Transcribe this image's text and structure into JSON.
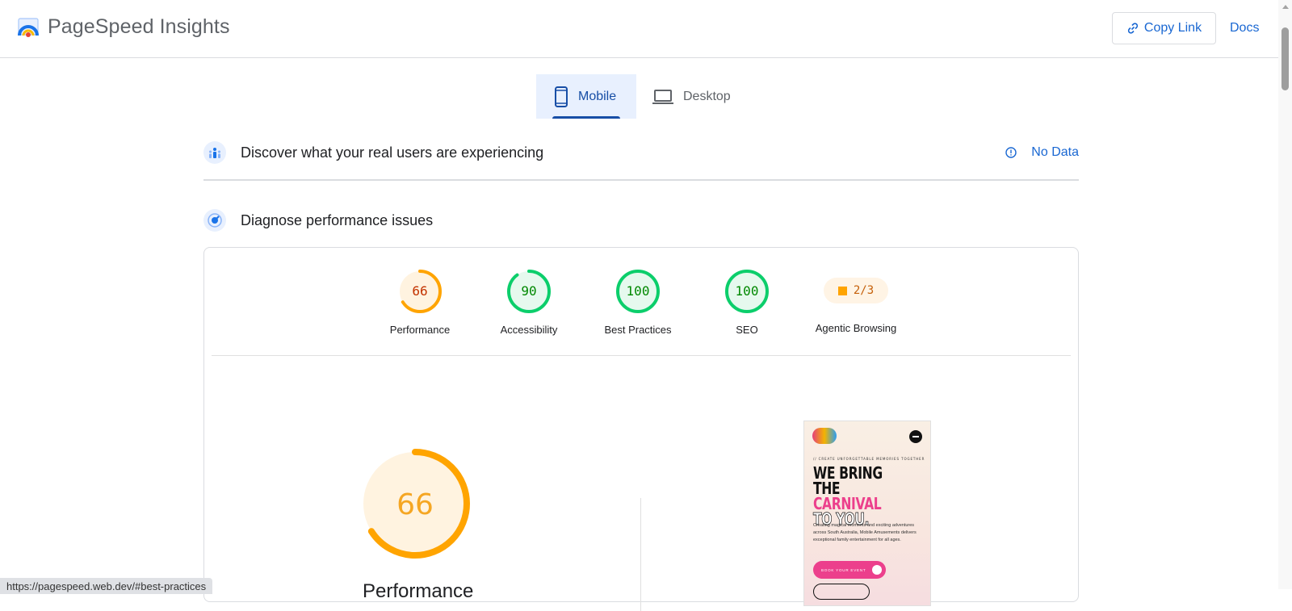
{
  "header": {
    "app_title": "PageSpeed Insights",
    "copy_link_label": "Copy Link",
    "docs_label": "Docs"
  },
  "tabs": [
    {
      "label": "Mobile",
      "selected": true
    },
    {
      "label": "Desktop",
      "selected": false
    }
  ],
  "real_users": {
    "title": "Discover what your real users are experiencing",
    "no_data_label": "No Data"
  },
  "diagnose": {
    "title": "Diagnose performance issues"
  },
  "scores": [
    {
      "label": "Performance",
      "value": "66",
      "fraction": 0.66,
      "status": "average"
    },
    {
      "label": "Accessibility",
      "value": "90",
      "fraction": 0.9,
      "status": "pass"
    },
    {
      "label": "Best Practices",
      "value": "100",
      "fraction": 1.0,
      "status": "pass"
    },
    {
      "label": "SEO",
      "value": "100",
      "fraction": 1.0,
      "status": "pass"
    },
    {
      "label": "Agentic Browsing",
      "value": "2/3",
      "status": "average"
    }
  ],
  "performance_detail": {
    "score": "66",
    "fraction": 0.66,
    "title": "Performance"
  },
  "page_screenshot": {
    "tagline": "// CREATE UNFORGETTABLE MEMORIES TOGETHER",
    "heading_line1": "WE BRING THE",
    "heading_line2": "CARNIVAL",
    "heading_line3": "TO YOU.",
    "body": "Creating magical moments and exciting adventures across South Australia, Mobile Amusements delivers exceptional family entertainment for all ages.",
    "cta": "BOOK YOUR EVENT"
  },
  "status_bar": {
    "url": "https://pagespeed.web.dev/#best-practices"
  },
  "colors": {
    "accent": "#1967d2",
    "pass": "#0cce6b",
    "pass_text": "#008800",
    "average": "#ffa400",
    "average_text": "#c33300"
  }
}
